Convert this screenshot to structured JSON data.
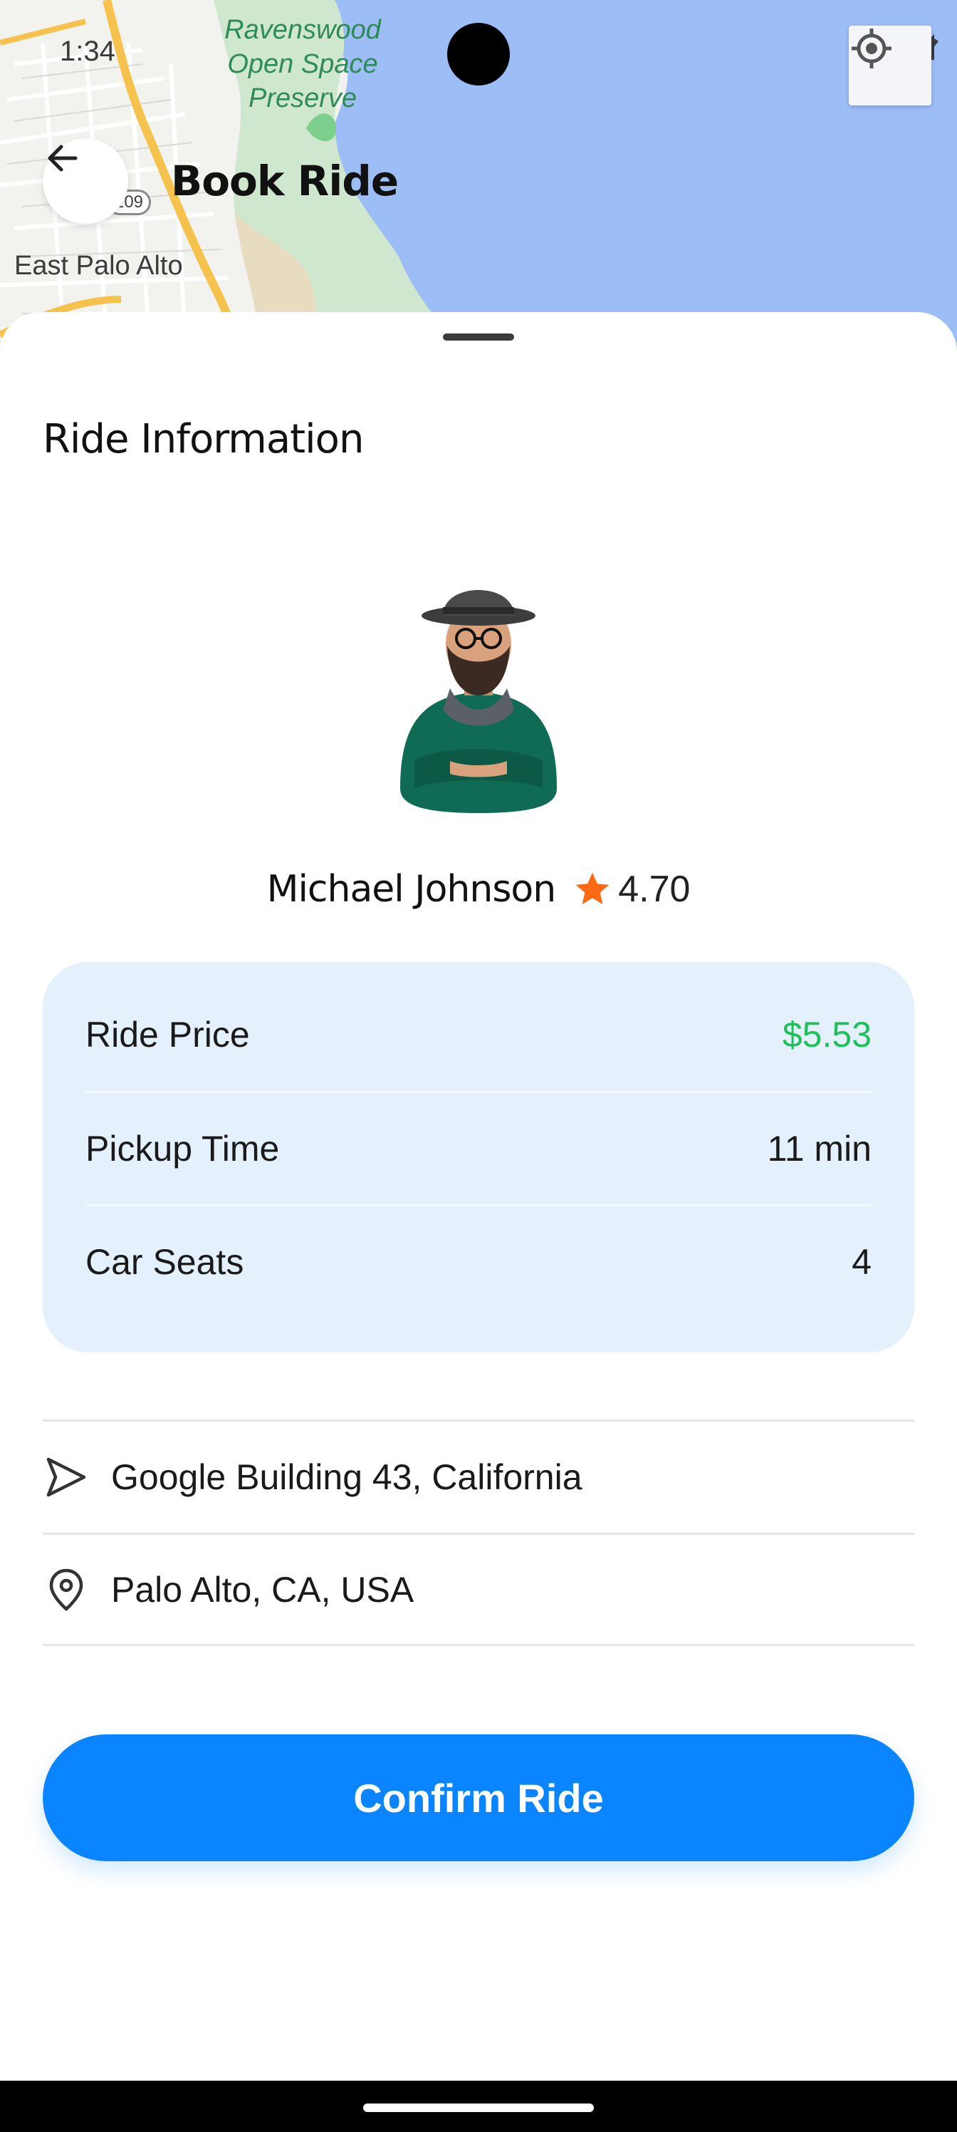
{
  "status_bar": {
    "time": "1:34"
  },
  "map": {
    "park_label": "Ravenswood Open Space Preserve",
    "city_label": "East Palo Alto",
    "route_shield": "109",
    "colors": {
      "water": "#9dbdf6",
      "land": "#f2f2ef",
      "park": "#cfe6cf",
      "road": "#f5c24d"
    }
  },
  "header": {
    "title": "Book Ride",
    "back_icon": "arrow-left-icon"
  },
  "sheet": {
    "section_title": "Ride Information",
    "driver": {
      "name": "Michael Johnson",
      "rating": "4.70",
      "rating_icon": "star-icon"
    },
    "info": [
      {
        "label": "Ride Price",
        "value": "$5.53"
      },
      {
        "label": "Pickup Time",
        "value": "11 min"
      },
      {
        "label": "Car Seats",
        "value": "4"
      }
    ],
    "addresses": [
      {
        "icon": "navigation-arrow-icon",
        "text": "Google Building 43, California"
      },
      {
        "icon": "location-pin-icon",
        "text": "Palo Alto, CA, USA"
      }
    ],
    "confirm_label": "Confirm Ride"
  },
  "colors": {
    "accent": "#0a84ff",
    "price": "#1fbf5c",
    "card_bg": "#e5f0fd",
    "star": "#ff6a13"
  }
}
